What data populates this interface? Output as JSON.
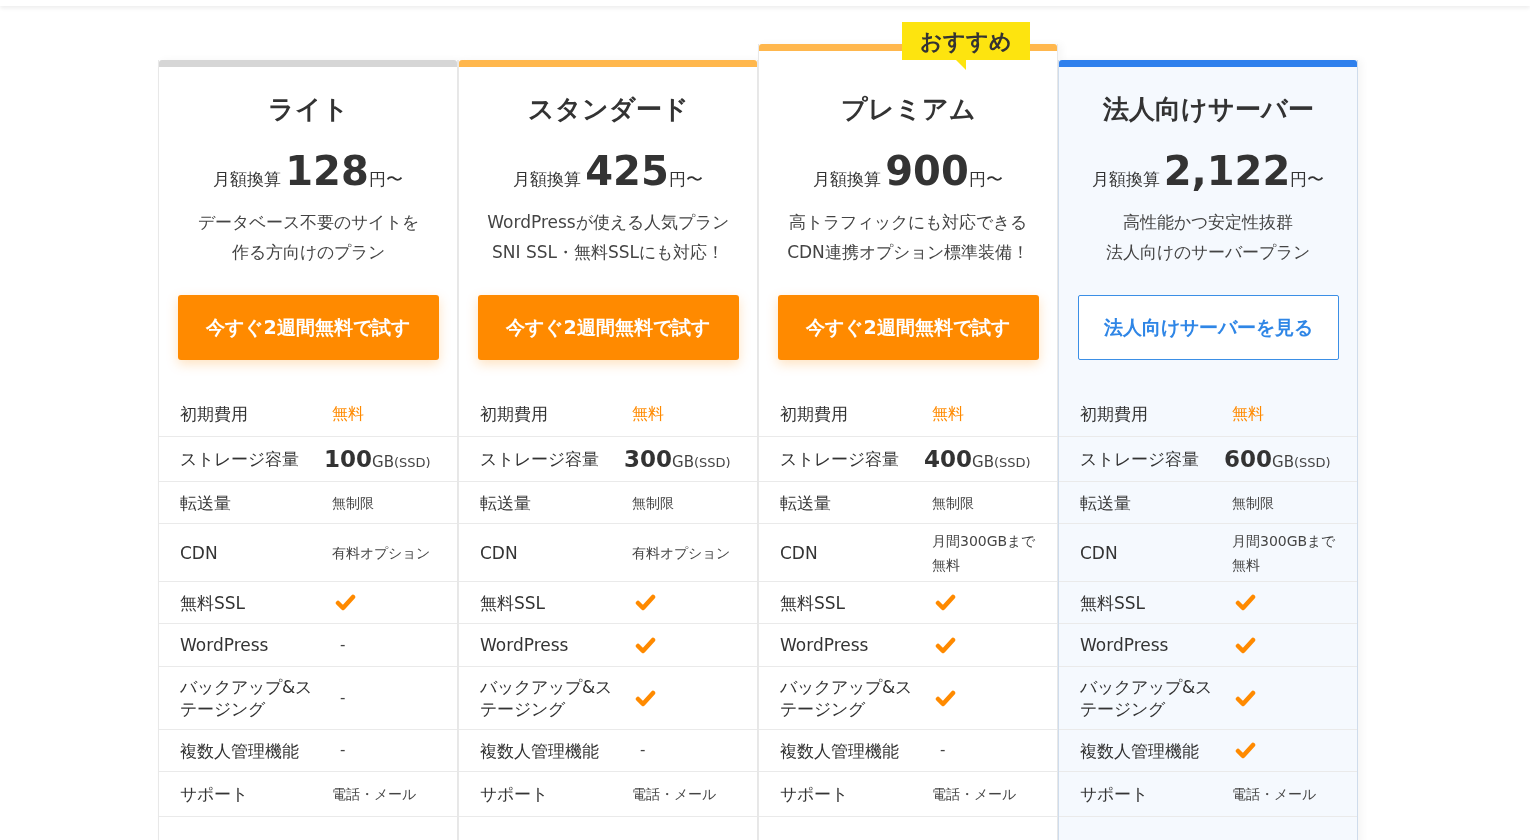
{
  "plans": [
    {
      "name": "ライト",
      "color": "#d6d6d6",
      "recommended": false,
      "tinted": false,
      "price_prefix": "月額換算",
      "price": "128",
      "price_suffix": "円〜",
      "description": [
        "データベース不要のサイトを",
        "作る方向けのプラン"
      ],
      "button": {
        "label": "今すぐ2週間無料で試す",
        "kind": "primary"
      },
      "features": [
        {
          "label": "初期費用",
          "kind": "accent",
          "value": "無料"
        },
        {
          "label": "ストレージ容量",
          "kind": "storage",
          "value": "100",
          "unit": "GB",
          "note": "(SSD)"
        },
        {
          "label": "転送量",
          "kind": "text",
          "value": "無制限"
        },
        {
          "label": "CDN",
          "kind": "text",
          "value": "有料オプション"
        },
        {
          "label": "無料SSL",
          "kind": "check"
        },
        {
          "label": "WordPress",
          "kind": "dash",
          "value": "-"
        },
        {
          "label": "バックアップ&ステージング",
          "kind": "dash",
          "value": "-"
        },
        {
          "label": "複数人管理機能",
          "kind": "dash",
          "value": "-"
        },
        {
          "label": "サポート",
          "kind": "text",
          "value": "電話・メール"
        }
      ]
    },
    {
      "name": "スタンダード",
      "color": "#ffb74d",
      "recommended": false,
      "tinted": false,
      "price_prefix": "月額換算",
      "price": "425",
      "price_suffix": "円〜",
      "description": [
        "WordPressが使える人気プラン",
        "SNI SSL・無料SSLにも対応！"
      ],
      "button": {
        "label": "今すぐ2週間無料で試す",
        "kind": "primary"
      },
      "features": [
        {
          "label": "初期費用",
          "kind": "accent",
          "value": "無料"
        },
        {
          "label": "ストレージ容量",
          "kind": "storage",
          "value": "300",
          "unit": "GB",
          "note": "(SSD)"
        },
        {
          "label": "転送量",
          "kind": "text",
          "value": "無制限"
        },
        {
          "label": "CDN",
          "kind": "text",
          "value": "有料オプション"
        },
        {
          "label": "無料SSL",
          "kind": "check"
        },
        {
          "label": "WordPress",
          "kind": "check"
        },
        {
          "label": "バックアップ&ステージング",
          "kind": "check"
        },
        {
          "label": "複数人管理機能",
          "kind": "dash",
          "value": "-"
        },
        {
          "label": "サポート",
          "kind": "text",
          "value": "電話・メール"
        }
      ]
    },
    {
      "name": "プレミアム",
      "color": "#ffb74d",
      "recommended": true,
      "badge": "おすすめ",
      "tinted": false,
      "price_prefix": "月額換算",
      "price": "900",
      "price_suffix": "円〜",
      "description": [
        "高トラフィックにも対応できる",
        "CDN連携オプション標準装備！"
      ],
      "button": {
        "label": "今すぐ2週間無料で試す",
        "kind": "primary"
      },
      "features": [
        {
          "label": "初期費用",
          "kind": "accent",
          "value": "無料"
        },
        {
          "label": "ストレージ容量",
          "kind": "storage",
          "value": "400",
          "unit": "GB",
          "note": "(SSD)"
        },
        {
          "label": "転送量",
          "kind": "text",
          "value": "無制限"
        },
        {
          "label": "CDN",
          "kind": "text",
          "value": "月間300GBまで無料"
        },
        {
          "label": "無料SSL",
          "kind": "check"
        },
        {
          "label": "WordPress",
          "kind": "check"
        },
        {
          "label": "バックアップ&ステージング",
          "kind": "check"
        },
        {
          "label": "複数人管理機能",
          "kind": "dash",
          "value": "-"
        },
        {
          "label": "サポート",
          "kind": "text",
          "value": "電話・メール"
        }
      ]
    },
    {
      "name": "法人向けサーバー",
      "color": "#2f80ed",
      "recommended": false,
      "tinted": true,
      "price_prefix": "月額換算",
      "price": "2,122",
      "price_suffix": "円〜",
      "description": [
        "高性能かつ安定性抜群",
        "法人向けのサーバープラン"
      ],
      "button": {
        "label": "法人向けサーバーを見る",
        "kind": "outline"
      },
      "features": [
        {
          "label": "初期費用",
          "kind": "accent",
          "value": "無料"
        },
        {
          "label": "ストレージ容量",
          "kind": "storage",
          "value": "600",
          "unit": "GB",
          "note": "(SSD)"
        },
        {
          "label": "転送量",
          "kind": "text",
          "value": "無制限"
        },
        {
          "label": "CDN",
          "kind": "text",
          "value": "月間300GBまで無料"
        },
        {
          "label": "無料SSL",
          "kind": "check"
        },
        {
          "label": "WordPress",
          "kind": "check"
        },
        {
          "label": "バックアップ&ステージング",
          "kind": "check"
        },
        {
          "label": "複数人管理機能",
          "kind": "check"
        },
        {
          "label": "サポート",
          "kind": "text",
          "value": "電話・メール"
        }
      ]
    }
  ]
}
